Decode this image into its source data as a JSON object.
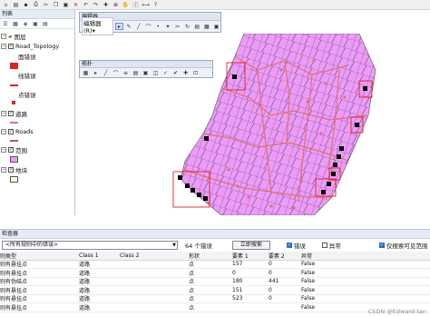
{
  "toc": {
    "title": "列表",
    "layers_root": "图层",
    "layers": [
      {
        "label": "Road_Topology"
      },
      {
        "label": "面错误"
      },
      {
        "label": "线错误"
      },
      {
        "label": "点错误"
      },
      {
        "label": "道路"
      },
      {
        "label": "Roads"
      },
      {
        "label": "范围"
      },
      {
        "label": "地块"
      }
    ]
  },
  "editor": {
    "title": "编辑器",
    "menu_label": "编辑器(R)▾"
  },
  "float_toolbar": {
    "title": "拓扑"
  },
  "checker": {
    "title": "检查器",
    "filter_select": "<所有规则中的错误>",
    "count_label": "64 个错误",
    "search_button": "立即搜索",
    "option_errors": "错误",
    "option_exceptions": "异常",
    "option_visible_extent": "仅搜索可见范围",
    "columns": [
      "则类型",
      "Class 1",
      "Class 2",
      "形状",
      "要素 1",
      "要素 2",
      "异常"
    ],
    "rows": [
      [
        "则有悬挂点",
        "道路",
        "",
        "点",
        "157",
        "0",
        "False"
      ],
      [
        "则有悬挂点",
        "道路",
        "",
        "点",
        "0",
        "0",
        "False"
      ],
      [
        "则有伪结点",
        "道路",
        "",
        "点",
        "180",
        "441",
        "False"
      ],
      [
        "则有悬挂点",
        "道路",
        "",
        "点",
        "151",
        "0",
        "False"
      ],
      [
        "则有悬挂点",
        "道路",
        "",
        "点",
        "523",
        "0",
        "False"
      ],
      [
        "则有悬挂点",
        "道路",
        "",
        "点",
        "",
        "",
        "False"
      ]
    ]
  },
  "watermark": "CSDN @Edward-tan",
  "colors": {
    "polygon_fill": "#ec9cf8",
    "road_line": "#e07070",
    "error_box": "#e02020",
    "error_point": "#000000"
  }
}
